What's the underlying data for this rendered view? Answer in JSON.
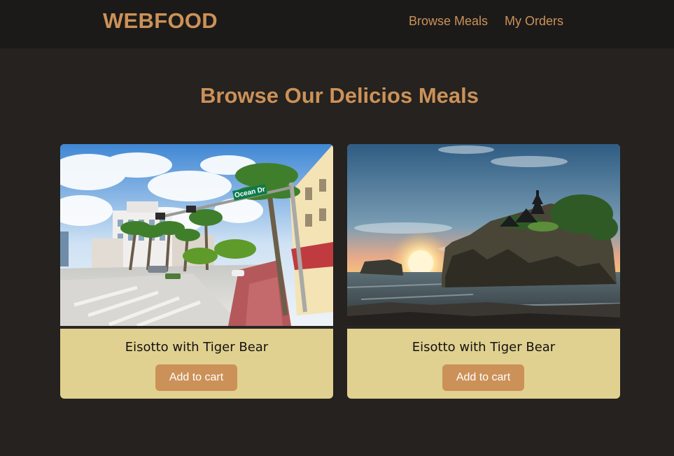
{
  "header": {
    "logo": "WEBFOOD",
    "nav": [
      {
        "label": "Browse Meals"
      },
      {
        "label": "My Orders"
      }
    ]
  },
  "main": {
    "heading": "Browse Our Delicios Meals",
    "meals": [
      {
        "name": "Eisotto with Tiger Bear",
        "button_label": "Add to cart",
        "image_alt": "Street with palm trees and an Ocean Dr sign",
        "image_sign_text": "Ocean Dr"
      },
      {
        "name": "Eisotto with Tiger Bear",
        "button_label": "Add to cart",
        "image_alt": "Temple on a rocky island at sunset"
      }
    ]
  },
  "colors": {
    "accent": "#cc9158",
    "header_bg": "#1b1a19",
    "page_bg": "#25221f",
    "card_bg": "#e1d190"
  }
}
